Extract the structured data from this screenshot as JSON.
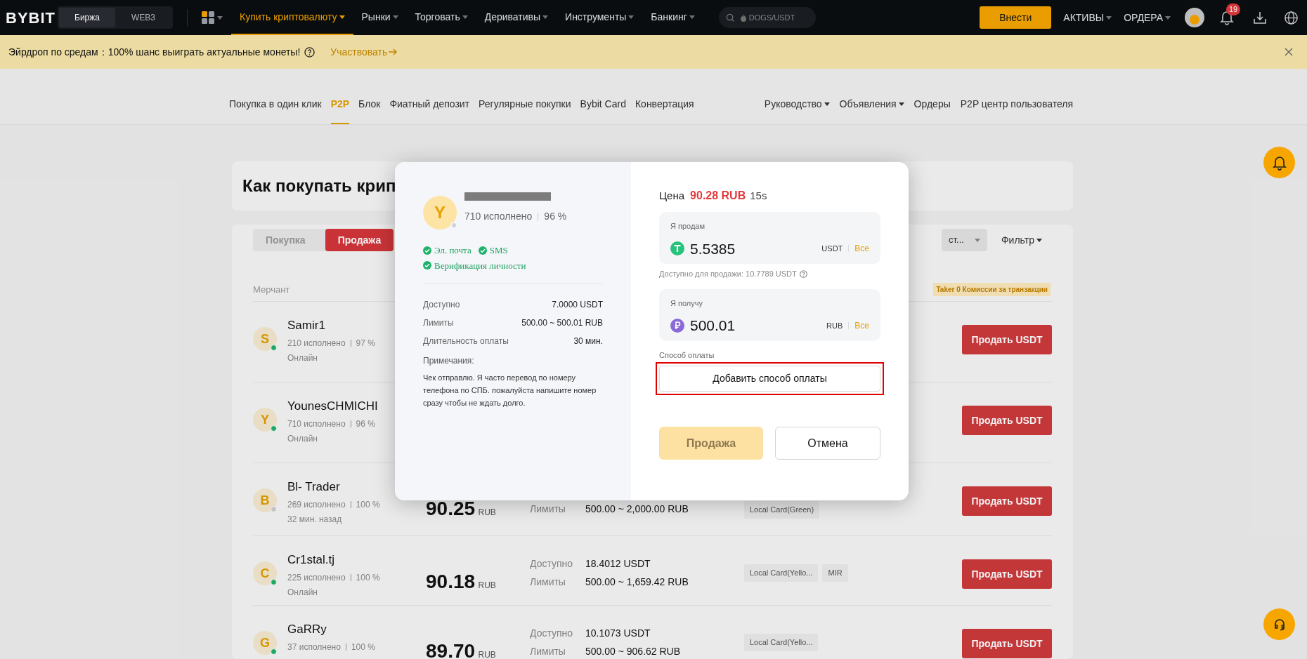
{
  "top_nav": {
    "logo": "BYBIT",
    "mode_tabs": [
      {
        "label": "Биржа",
        "selected": true
      },
      {
        "label": "WEB3",
        "selected": false
      }
    ],
    "menu": [
      {
        "label": "Купить криптовалюту",
        "selected": true
      },
      {
        "label": "Рынки",
        "selected": false
      },
      {
        "label": "Торговать",
        "selected": false
      },
      {
        "label": "Деривативы",
        "selected": false
      },
      {
        "label": "Инструменты",
        "selected": false
      },
      {
        "label": "Банкинг",
        "selected": false
      }
    ],
    "search": {
      "placeholder": "DOGS/USDT"
    },
    "deposit_button": "Внести",
    "account_menu": [
      "АКТИВЫ",
      "ОРДЕРА"
    ],
    "notification_count": "19"
  },
  "banner": {
    "text": "Эйрдроп по средам：100% шанс выиграть актуальные монеты!",
    "link": "Участвовать"
  },
  "sub_nav": {
    "left": [
      {
        "label": "Покупка в один клик",
        "selected": false
      },
      {
        "label": "P2P",
        "selected": true
      },
      {
        "label": "Блок",
        "selected": false
      },
      {
        "label": "Фиатный депозит",
        "selected": false
      },
      {
        "label": "Регулярные покупки",
        "selected": false
      },
      {
        "label": "Bybit Card",
        "selected": false
      },
      {
        "label": "Конвертация",
        "selected": false
      }
    ],
    "right": [
      {
        "label": "Руководство",
        "dropdown": true
      },
      {
        "label": "Объявления",
        "dropdown": true
      },
      {
        "label": "Ордеры",
        "dropdown": false
      },
      {
        "label": "P2P центр пользователя",
        "dropdown": false
      }
    ]
  },
  "guide_card": {
    "title": "Как покупать крип"
  },
  "side_tabs": [
    {
      "label": "Покупка",
      "selected": false
    },
    {
      "label": "Продажа",
      "selected": true
    }
  ],
  "filters": {
    "dropdown": "ст...",
    "filter_button": "Фильтр"
  },
  "table": {
    "merchant_header": "Мерчант",
    "fee_badge": "Taker 0 Комиссии за транзакции",
    "rows": [
      {
        "initial": "S",
        "name": "Samir1",
        "orders": "210 исполнено",
        "rate": "97 %",
        "status": "Онлайн",
        "online": true,
        "button": "Продать USDT"
      },
      {
        "initial": "Y",
        "name": "YounesCHMICHI",
        "orders": "710 исполнено",
        "rate": "96 %",
        "status": "Онлайн",
        "online": true,
        "button": "Продать USDT"
      },
      {
        "initial": "B",
        "name": "Bl- Trader",
        "orders": "269 исполнено",
        "rate": "100 %",
        "status": "32 мин. назад",
        "online": false,
        "price": "90.25",
        "price_currency": "RUB",
        "limits_label": "Лимиты",
        "limits": "500.00 ~ 2,000.00 RUB",
        "tags": [
          "Local Card(Green)"
        ],
        "button": "Продать USDT"
      },
      {
        "initial": "C",
        "name": "Cr1stal.tj",
        "orders": "225 исполнено",
        "rate": "100 %",
        "status": "Онлайн",
        "online": true,
        "price": "90.18",
        "price_currency": "RUB",
        "available_label": "Доступно",
        "available": "18.4012 USDT",
        "limits_label": "Лимиты",
        "limits": "500.00 ~ 1,659.42 RUB",
        "tags": [
          "Local Card(Yello...",
          "MIR"
        ],
        "button": "Продать USDT"
      },
      {
        "initial": "G",
        "name": "GaRRy",
        "orders": "37 исполнено",
        "rate": "100 %",
        "online": true,
        "price": "89.70",
        "price_currency": "RUB",
        "available_label": "Доступно",
        "available": "10.1073 USDT",
        "limits_label": "Лимиты",
        "limits": "500.00 ~ 906.62 RUB",
        "tags": [
          "Local Card(Yello..."
        ],
        "button": "Продать USDT"
      }
    ]
  },
  "modal": {
    "merchant": {
      "initial": "Y",
      "online": false,
      "orders": "710 исполнено",
      "rate": "96 %"
    },
    "verifications": [
      "Эл. почта",
      "SMS",
      "Верификация личности"
    ],
    "details": [
      {
        "label": "Доступно",
        "value": "7.0000 USDT"
      },
      {
        "label": "Лимиты",
        "value": "500.00 ~ 500.01 RUB"
      },
      {
        "label": "Длительность оплаты",
        "value": "30 мин."
      }
    ],
    "notes_label": "Примечания:",
    "notes": "Чек отправлю. Я часто перевод по номеру телефона по СПБ. пожалуйста напишите номер сразу чтобы не ждать долго.",
    "price_label": "Цена",
    "price": "90.28 RUB",
    "timer": "15s",
    "fields": [
      {
        "label": "Я продам",
        "value": "5.5385",
        "currency": "USDT",
        "max_link": "Все"
      },
      {
        "label": "Я получу",
        "value": "500.01",
        "currency": "RUB",
        "max_link": "Все"
      }
    ],
    "available_note": "Доступно для продажи: 10.7789 USDT",
    "payment_label": "Способ оплаты",
    "payment_button": "Добавить способ оплаты",
    "payment_highlighted": true,
    "actions": [
      {
        "label": "Продажа",
        "kind": "primary",
        "disabled": true
      },
      {
        "label": "Отмена",
        "kind": "secondary",
        "disabled": false
      }
    ]
  }
}
